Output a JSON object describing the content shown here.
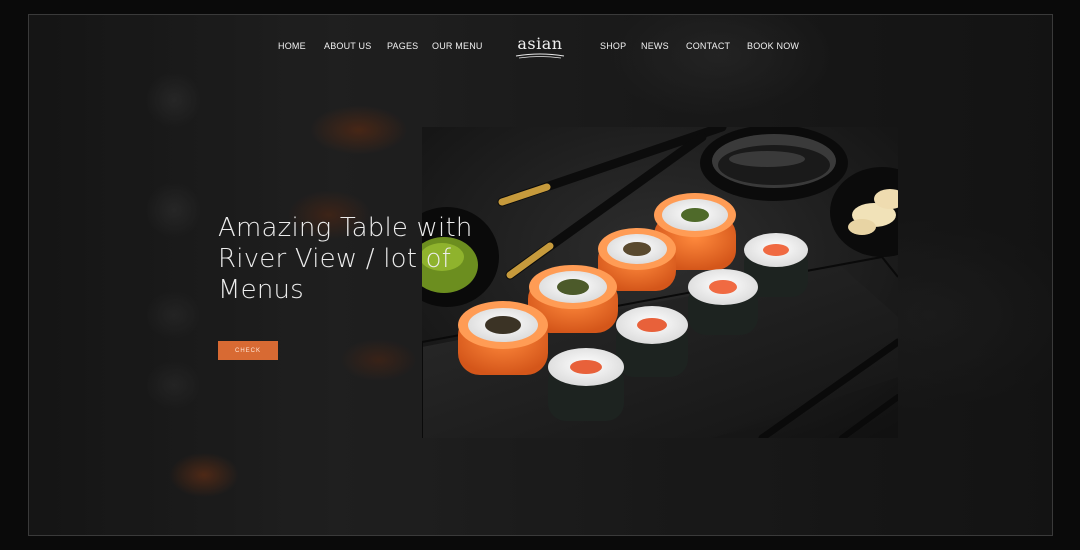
{
  "nav": {
    "left_items": [
      {
        "label": "HOME"
      },
      {
        "label": "ABOUT US"
      },
      {
        "label": "PAGES"
      },
      {
        "label": "OUR MENU"
      }
    ],
    "logo_text": "asian",
    "right_items": [
      {
        "label": "SHOP"
      },
      {
        "label": "NEWS"
      },
      {
        "label": "CONTACT"
      },
      {
        "label": "BOOK NOW"
      }
    ]
  },
  "hero": {
    "title_line1": "Amazing Table with",
    "title_line2": "River View / lot of",
    "title_line3": "Menus",
    "button_label": "CHECK"
  },
  "colors": {
    "accent": "#d86a33",
    "background": "#1e1e1e",
    "text": "#ececec"
  },
  "photo": {
    "subject": "sushi-rolls-on-slate-board"
  }
}
